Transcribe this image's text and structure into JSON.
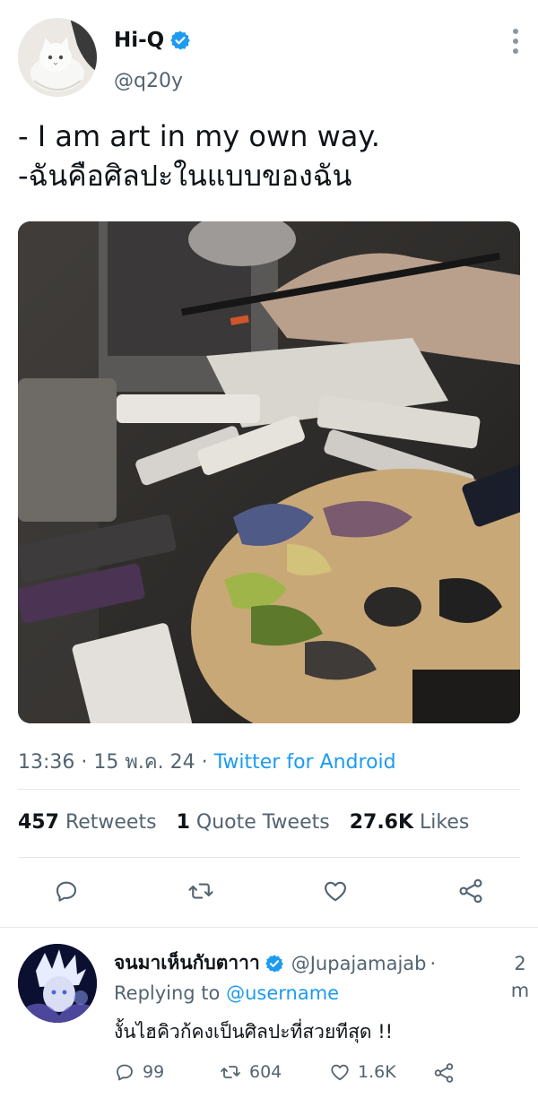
{
  "tweet": {
    "author": {
      "display_name": "Hi-Q",
      "handle": "@q20y",
      "verified": true,
      "avatar_icon": "cat-avatar-icon"
    },
    "text_lines": [
      "- I am art in my own way.",
      "-ฉันคือศิลปะในแบบของฉัน"
    ],
    "media_icon": "painting-palette-photo",
    "time": "13:36",
    "date": "15 พ.ค. 24",
    "source": "Twitter for Android",
    "stats": {
      "retweets_count": "457",
      "retweets_label": "Retweets",
      "quotes_count": "1",
      "quotes_label": "Quote Tweets",
      "likes_count": "27.6K",
      "likes_label": "Likes"
    },
    "actions": [
      "reply-icon",
      "retweet-icon",
      "like-icon",
      "share-icon"
    ]
  },
  "reply": {
    "display_name": "จนมาเห็นกับตาาา",
    "handle": "@Jupajamajab",
    "separator": "·",
    "time": "2m",
    "replying_prefix": "Replying to",
    "replying_to": "@username",
    "text": "งั้นไฮคิวก้คงเป็นศิลปะที่สวยทีสุด !!",
    "counts": {
      "replies": "99",
      "retweets": "604",
      "likes": "1.6K"
    }
  },
  "colors": {
    "accent": "#1d9bf0",
    "text_primary": "#0f1419",
    "text_secondary": "#536471",
    "divider": "#e4e8eb"
  }
}
